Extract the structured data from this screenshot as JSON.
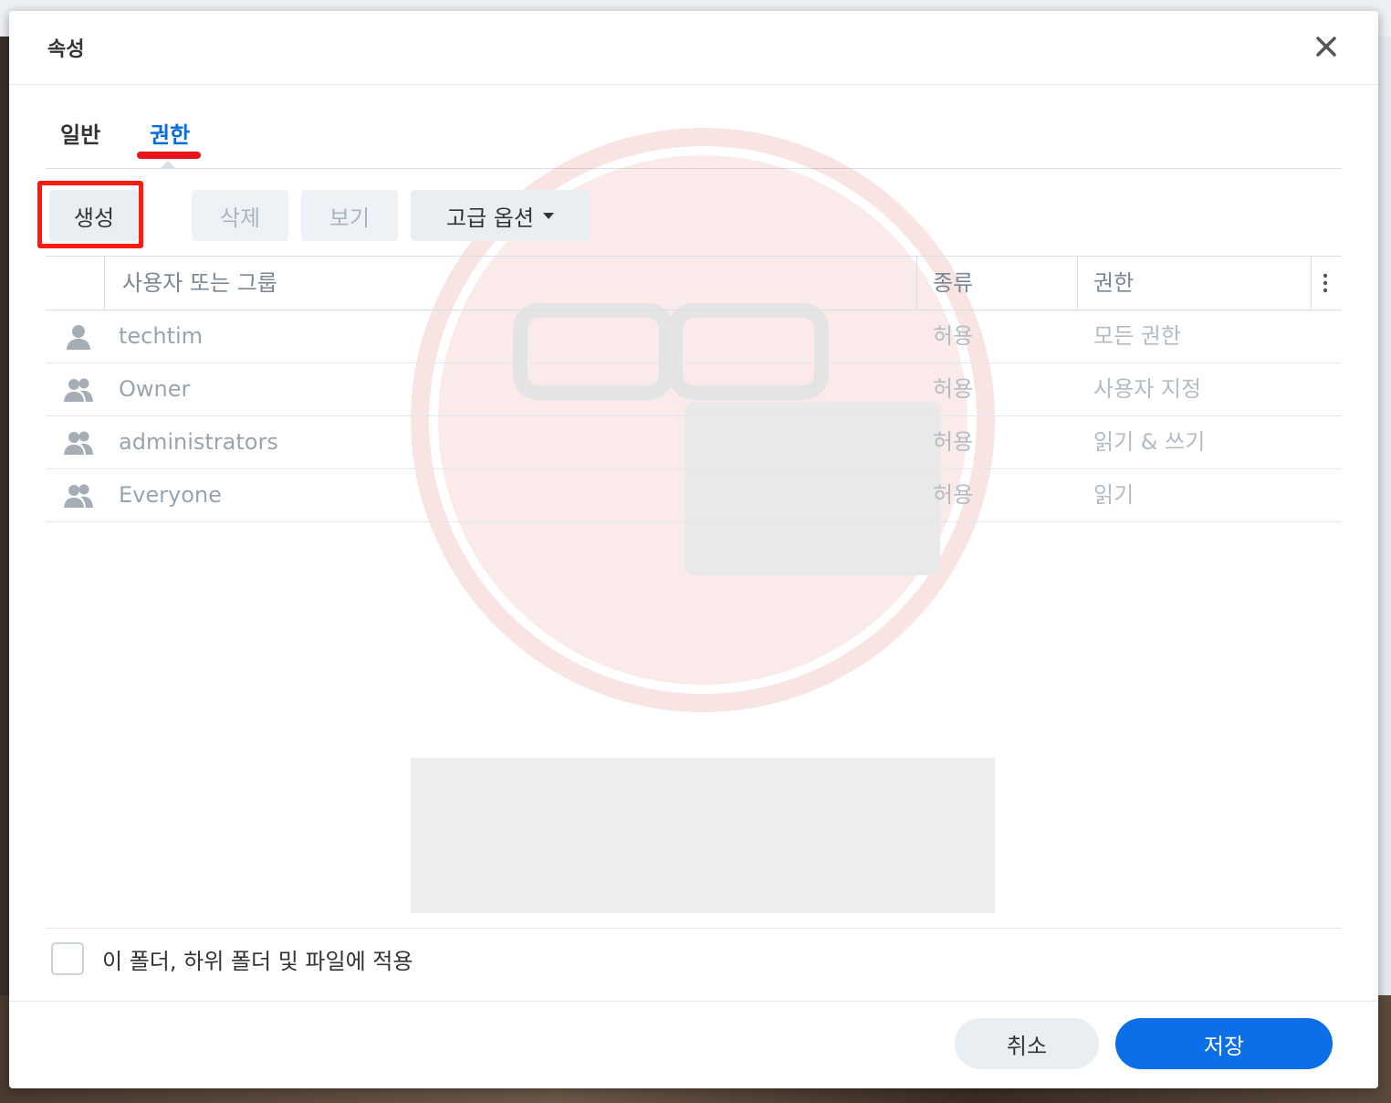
{
  "dialog": {
    "title": "속성"
  },
  "tabs": [
    {
      "label": "일반",
      "active": false
    },
    {
      "label": "권한",
      "active": true
    }
  ],
  "toolbar": {
    "create_label": "생성",
    "delete_label": "삭제",
    "view_label": "보기",
    "advanced_label": "고급 옵션"
  },
  "table": {
    "columns": [
      "사용자 또는 그룹",
      "종류",
      "권한"
    ],
    "rows": [
      {
        "icon": "user-icon",
        "name": "techtim",
        "type": "허용",
        "permission": "모든 권한"
      },
      {
        "icon": "group-icon",
        "name": "Owner",
        "type": "허용",
        "permission": "사용자 지정"
      },
      {
        "icon": "group-icon",
        "name": "administrators",
        "type": "허용",
        "permission": "읽기 & 쓰기"
      },
      {
        "icon": "group-icon",
        "name": "Everyone",
        "type": "허용",
        "permission": "읽기"
      }
    ]
  },
  "apply": {
    "label": "이 폴더, 하위 폴더 및 파일에 적용",
    "checked": false
  },
  "footer": {
    "cancel_label": "취소",
    "save_label": "저장"
  },
  "colors": {
    "accent": "#0b6fe8",
    "highlight": "#ff1a10"
  }
}
